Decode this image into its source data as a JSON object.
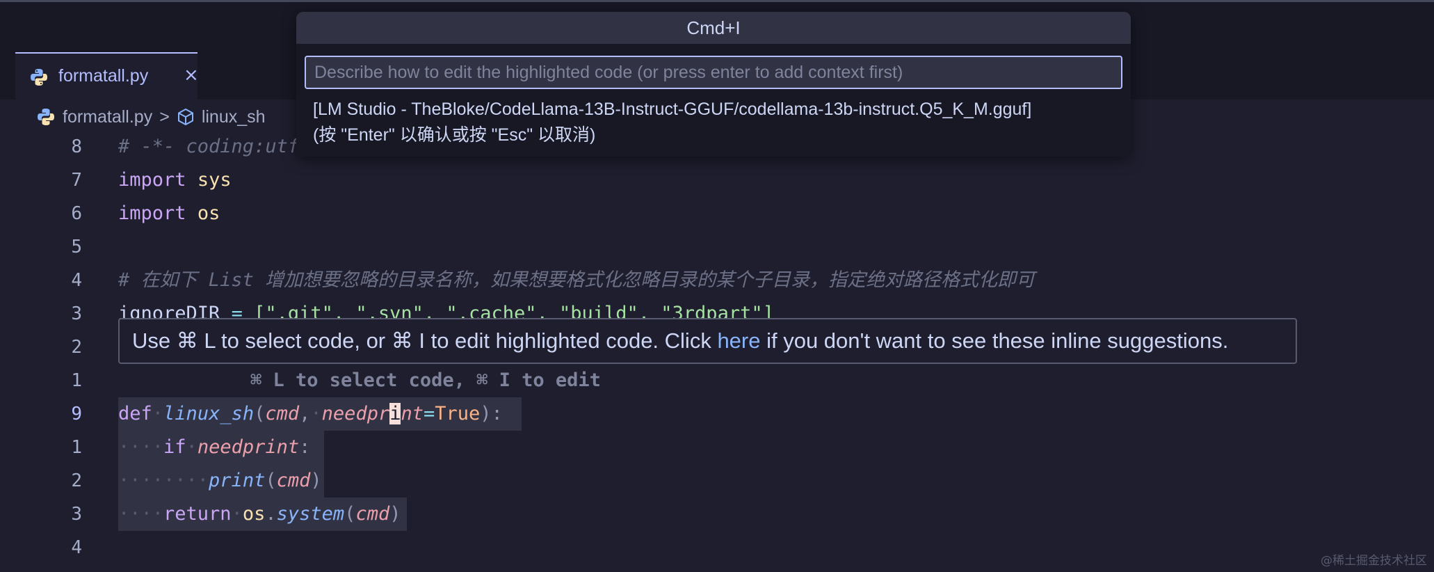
{
  "tab": {
    "filename": "formatall.py",
    "close_glyph": "×"
  },
  "breadcrumb": {
    "file": "formatall.py",
    "separator": ">",
    "symbol": "linux_sh"
  },
  "gutter": [
    "8",
    "7",
    "6",
    "5",
    "4",
    "3",
    "2",
    "1",
    "9",
    "1",
    "2",
    "3",
    "4"
  ],
  "code": {
    "line8": "# -*- coding:utf",
    "line7_kw": "import",
    "line7_mod": "sys",
    "line6_kw": "import",
    "line6_mod": "os",
    "line4": "# 在如下 List 增加想要忽略的目录名称，如果想要格式化忽略目录的某个子目录，指定绝对路径格式化即可",
    "line3_var": "ignoreDIR",
    "line3_eq": " = ",
    "line3_list": "[\".git\", \".svn\", \".cache\", \"build\", \"3rdpart\"]",
    "def_kw": "def",
    "def_fn": "linux_sh",
    "def_p1": "cmd",
    "def_p2a": "needpr",
    "def_cursor": "i",
    "def_p2b": "nt",
    "def_true": "True",
    "if_kw": "if",
    "if_var": "needprint",
    "print_fn": "print",
    "print_arg": "cmd",
    "ret_kw": "return",
    "ret_mod": "os",
    "ret_fn": "system",
    "ret_arg": "cmd"
  },
  "ghost_hint": "⌘ L to select code, ⌘ I to edit",
  "tooltip": {
    "before": "Use ⌘ L to select code, or ⌘ I to edit highlighted code. Click ",
    "link": "here",
    "after": " if you don't want to see these inline suggestions."
  },
  "palette": {
    "title": "Cmd+I",
    "placeholder": "Describe how to edit the highlighted code (or press enter to add context first)",
    "model": "[LM Studio - TheBloke/CodeLlama-13B-Instruct-GGUF/codellama-13b-instruct.Q5_K_M.gguf]",
    "hint": "(按 \"Enter\" 以确认或按 \"Esc\" 以取消)"
  },
  "watermark": "@稀土掘金技术社区",
  "colors": {
    "accent": "#b4befe",
    "background": "#1e1e2e",
    "link": "#89b4fa"
  }
}
